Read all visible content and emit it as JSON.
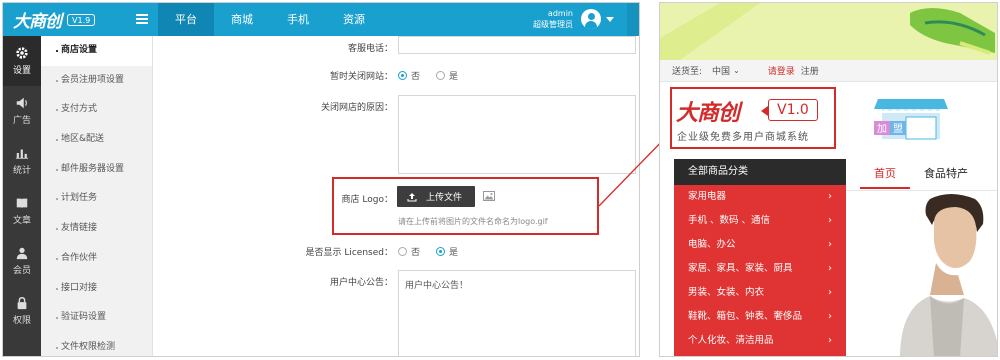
{
  "admin": {
    "logo_text": "大商创",
    "version": "V1.9",
    "nav_tabs": [
      {
        "label": "平台",
        "active": true
      },
      {
        "label": "商城",
        "active": false
      },
      {
        "label": "手机",
        "active": false
      },
      {
        "label": "资源",
        "active": false
      }
    ],
    "user": {
      "name": "admin",
      "role": "超级管理员"
    },
    "dark_sidebar": [
      {
        "label": "设置",
        "icon": "gear-icon",
        "active": true
      },
      {
        "label": "广告",
        "icon": "speaker-icon",
        "active": false
      },
      {
        "label": "统计",
        "icon": "chart-icon",
        "active": false
      },
      {
        "label": "文章",
        "icon": "book-icon",
        "active": false
      },
      {
        "label": "会员",
        "icon": "user-icon",
        "active": false
      },
      {
        "label": "权限",
        "icon": "lock-icon",
        "active": false
      }
    ],
    "sub_menu": [
      {
        "label": "商店设置",
        "active": true
      },
      {
        "label": "会员注册项设置",
        "active": false
      },
      {
        "label": "支付方式",
        "active": false
      },
      {
        "label": "地区&配送",
        "active": false
      },
      {
        "label": "邮件服务器设置",
        "active": false
      },
      {
        "label": "计划任务",
        "active": false
      },
      {
        "label": "友情链接",
        "active": false
      },
      {
        "label": "合作伙伴",
        "active": false
      },
      {
        "label": "接口对接",
        "active": false
      },
      {
        "label": "验证码设置",
        "active": false
      },
      {
        "label": "文件权限检测",
        "active": false
      }
    ],
    "form": {
      "phone_label": "客服电话：",
      "phone_value": "",
      "close_label": "暂时关闭网站：",
      "close_options": [
        "否",
        "是"
      ],
      "close_selected": "否",
      "reason_label": "关闭网店的原因：",
      "reason_value": "",
      "logo_label": "商店 Logo：",
      "upload_label": "上传文件",
      "upload_hint": "请在上传前将图片的文件名命名为logo.gif",
      "licensed_label": "是否显示 Licensed：",
      "licensed_options": [
        "否",
        "是"
      ],
      "licensed_selected": "是",
      "notice_label": "用户中心公告：",
      "notice_value": "用户中心公告！"
    }
  },
  "store": {
    "topline": {
      "ship_label": "送货至:",
      "region": "中国",
      "login": "请登录",
      "register": "注册"
    },
    "logo_text": "大商创",
    "version": "V1.0",
    "slogan": "企业级免费多用户商城系统",
    "shop_sign": [
      "加",
      "盟"
    ],
    "category_header": "全部商品分类",
    "categories": [
      "家用电器",
      "手机 、数码 、通信",
      "电脑、办公",
      "家居、家具、家装、厨具",
      "男装、女装、内衣",
      "鞋靴、箱包、钟表、奢侈品",
      "个人化妆、清洁用品"
    ],
    "nav_tabs": [
      {
        "label": "首页",
        "active": true
      },
      {
        "label": "食品特产",
        "active": false
      }
    ]
  },
  "colors": {
    "admin_primary": "#19a0cf",
    "highlight_red": "#d32a2a",
    "category_red": "#e03434"
  }
}
